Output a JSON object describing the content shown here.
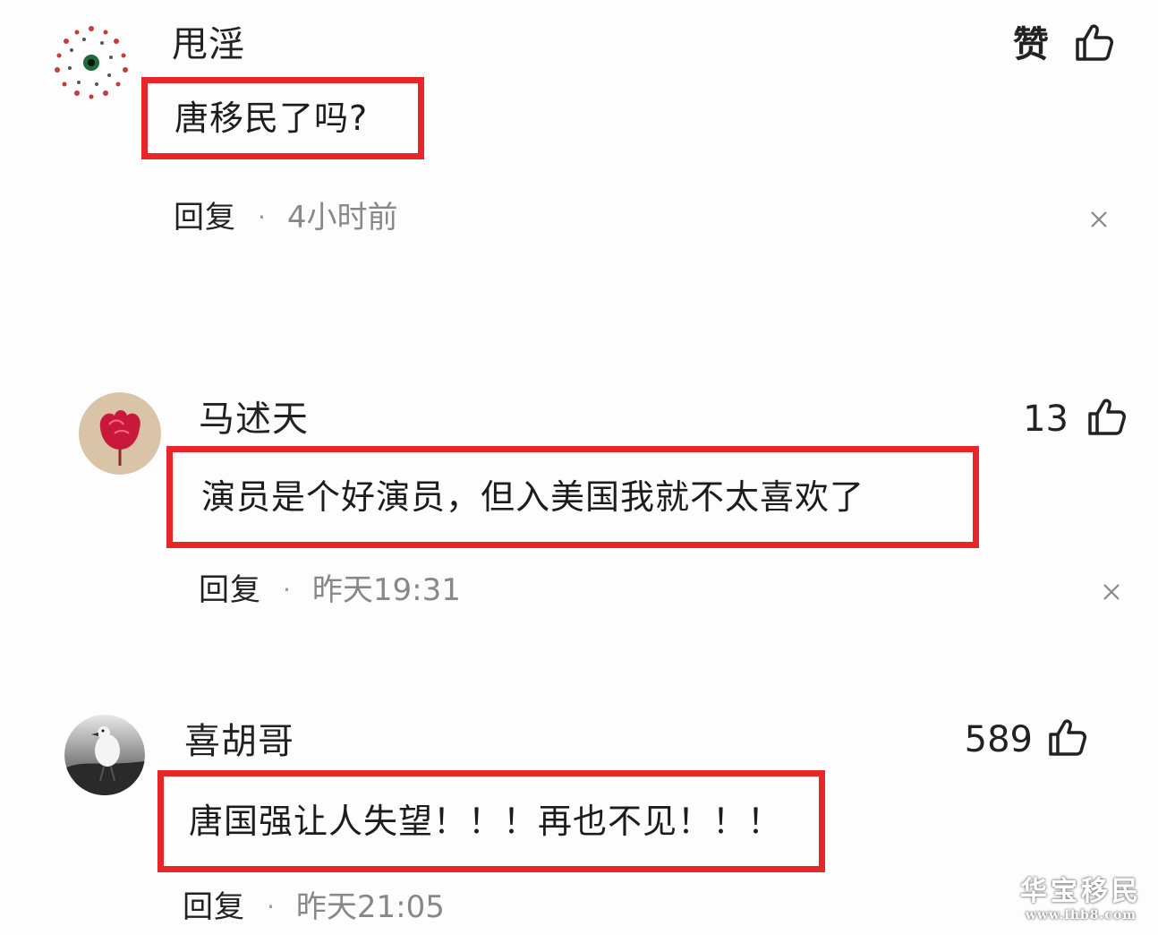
{
  "comments": [
    {
      "username": "甩淫",
      "like_label": "赞",
      "text": "唐移民了吗?",
      "reply_label": "回复",
      "separator": "·",
      "timestamp": "4小时前"
    },
    {
      "username": "马述天",
      "like_label": "13",
      "text": "演员是个好演员，但入美国我就不太喜欢了",
      "reply_label": "回复",
      "separator": "·",
      "timestamp": "昨天19:31"
    },
    {
      "username": "喜胡哥",
      "like_label": "589",
      "text": "唐国强让人失望！！！再也不见！！！",
      "reply_label": "回复",
      "separator": "·",
      "timestamp": "昨天21:05"
    }
  ],
  "watermark": {
    "title": "华宝移民",
    "url": "www.ihb8.com"
  },
  "colors": {
    "highlight_border": "#e8262a",
    "timestamp": "#888888",
    "text": "#1c1c1c"
  },
  "icons": [
    "avatar-dots",
    "avatar-rose",
    "avatar-bird",
    "thumbs-up-icon",
    "close-icon"
  ]
}
